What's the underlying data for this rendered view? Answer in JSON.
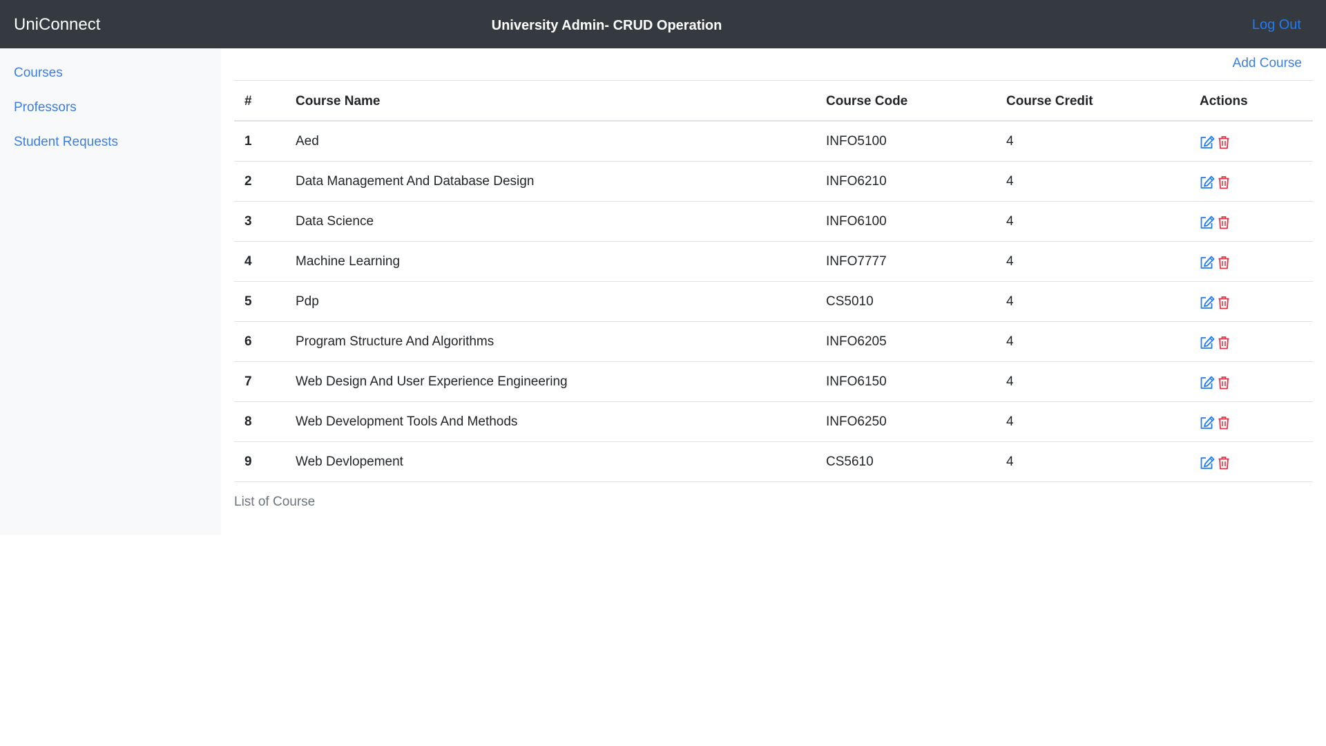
{
  "navbar": {
    "brand": "UniConnect",
    "title": "University Admin- CRUD Operation",
    "logout_label": "Log Out"
  },
  "sidebar": {
    "items": [
      {
        "label": "Courses"
      },
      {
        "label": "Professors"
      },
      {
        "label": "Student Requests"
      }
    ]
  },
  "main": {
    "add_course_label": "Add Course",
    "table": {
      "headers": [
        "#",
        "Course Name",
        "Course Code",
        "Course Credit",
        "Actions"
      ],
      "rows": [
        {
          "num": "1",
          "name": "Aed",
          "code": "INFO5100",
          "credit": "4"
        },
        {
          "num": "2",
          "name": "Data Management And Database Design",
          "code": "INFO6210",
          "credit": "4"
        },
        {
          "num": "3",
          "name": "Data Science",
          "code": "INFO6100",
          "credit": "4"
        },
        {
          "num": "4",
          "name": "Machine Learning",
          "code": "INFO7777",
          "credit": "4"
        },
        {
          "num": "5",
          "name": "Pdp",
          "code": "CS5010",
          "credit": "4"
        },
        {
          "num": "6",
          "name": "Program Structure And Algorithms",
          "code": "INFO6205",
          "credit": "4"
        },
        {
          "num": "7",
          "name": "Web Design And User Experience Engineering",
          "code": "INFO6150",
          "credit": "4"
        },
        {
          "num": "8",
          "name": "Web Development Tools And Methods",
          "code": "INFO6250",
          "credit": "4"
        },
        {
          "num": "9",
          "name": "Web Devlopement",
          "code": "CS5610",
          "credit": "4"
        }
      ],
      "row_actions": {
        "edit_icon": "edit-icon",
        "delete_icon": "trash-icon"
      }
    },
    "caption": "List of Course"
  },
  "colors": {
    "navbar_bg": "#343a40",
    "link": "#3d7ee0",
    "edit_icon": "#1f7bf5",
    "delete_icon": "#dc3545",
    "sidebar_bg": "#f8f9fa"
  }
}
